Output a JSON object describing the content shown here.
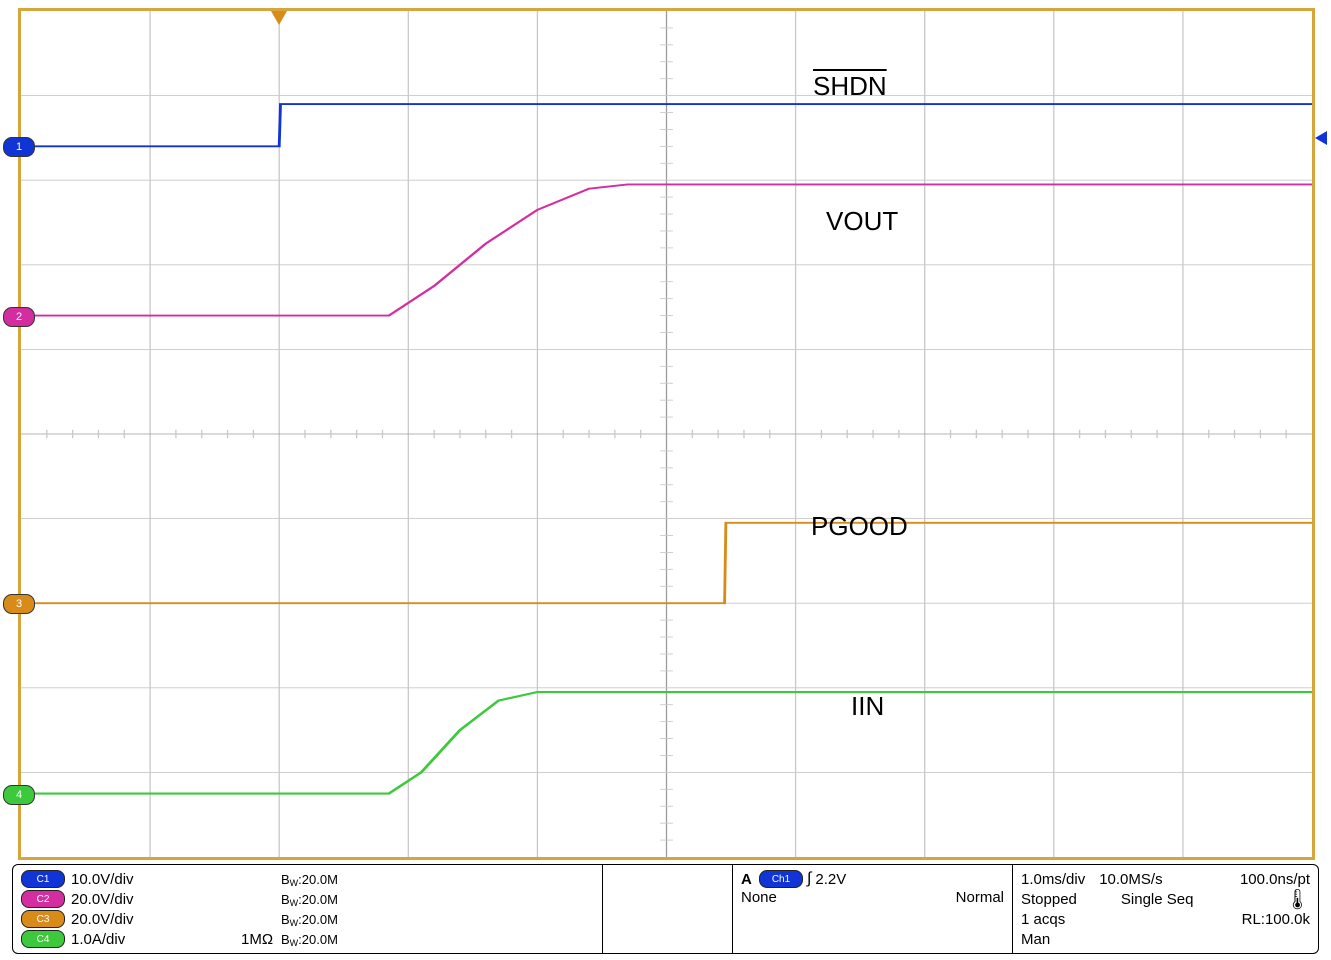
{
  "chart_data": {
    "type": "line",
    "description": "Oscilloscope capture, 4 channels, startup sequence",
    "x_unit": "ms",
    "x_per_div": 1.0,
    "x_divisions": 10,
    "x_range_ms": [
      0,
      10
    ],
    "series": [
      {
        "name": "SHDN",
        "channel": 1,
        "color": "#1034d6",
        "scale": "10.0V/div",
        "ground_div_from_top": 1.6,
        "x_ms": [
          0.0,
          2.0,
          2.01,
          10.0
        ],
        "y_div_from_ground": [
          0.0,
          0.0,
          0.5,
          0.5
        ]
      },
      {
        "name": "VOUT",
        "channel": 2,
        "color": "#d42da0",
        "scale": "20.0V/div",
        "ground_div_from_top": 3.6,
        "x_ms": [
          0.0,
          2.85,
          3.2,
          3.6,
          4.0,
          4.4,
          4.7,
          10.0
        ],
        "y_div_from_ground": [
          0.0,
          0.0,
          0.35,
          0.85,
          1.25,
          1.5,
          1.55,
          1.55
        ]
      },
      {
        "name": "PGOOD",
        "channel": 3,
        "color": "#d98b1a",
        "scale": "20.0V/div",
        "ground_div_from_top": 7.0,
        "x_ms": [
          0.0,
          5.45,
          5.46,
          10.0
        ],
        "y_div_from_ground": [
          0.0,
          0.0,
          0.95,
          0.95
        ]
      },
      {
        "name": "IIN",
        "channel": 4,
        "color": "#3cc93c",
        "scale": "1.0A/div",
        "ground_div_from_top": 9.25,
        "x_ms": [
          0.0,
          2.85,
          3.1,
          3.4,
          3.7,
          4.0,
          10.0
        ],
        "y_div_from_ground": [
          0.0,
          0.0,
          0.25,
          0.75,
          1.1,
          1.2,
          1.2
        ]
      }
    ],
    "trigger": {
      "source": "Ch1",
      "type": "rising-edge",
      "level": "2.2V",
      "position_ms": 2.0
    },
    "timebase": "1.0ms/div",
    "sample_rate": "10.0MS/s",
    "sample_period": "100.0ns/pt",
    "record_length": "100.0k",
    "acquisitions": 1,
    "run_state": "Stopped",
    "acquisition_mode": "Single Seq",
    "trigger_mode": "Man",
    "coupling_mode": "Normal"
  },
  "labels": {
    "ch1": "SHDN",
    "ch2": "VOUT",
    "ch3": "PGOOD",
    "ch4": "IIN"
  },
  "info": {
    "ch1scale": "10.0V/div",
    "ch2scale": "20.0V/div",
    "ch3scale": "20.0V/div",
    "ch4scale": "1.0A/div",
    "ch4imp": "1MΩ",
    "bw": "20.0M",
    "bw_prefix": "B",
    "bw_sub": "W",
    "bw_colon": ":",
    "trigA": "A",
    "trigCh": "Ch1",
    "trigLevel": "2.2V",
    "trigNone": "None",
    "trigNormal": "Normal",
    "timebase": "1.0ms/div",
    "samplerate": "10.0MS/s",
    "sampleperiod": "100.0ns/pt",
    "stopped": "Stopped",
    "singleseq": "Single Seq",
    "acqs": "1 acqs",
    "rl": "RL:100.0k",
    "man": "Man"
  }
}
